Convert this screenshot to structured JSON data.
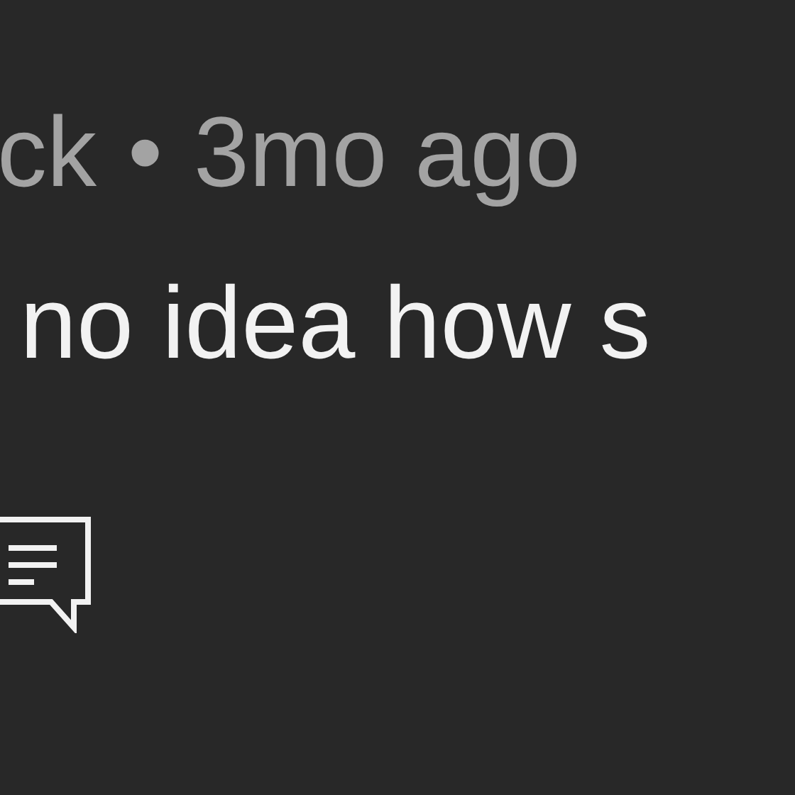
{
  "comment": {
    "author": "ck",
    "separator": "•",
    "time": "3mo ago",
    "text": "no idea how s"
  }
}
